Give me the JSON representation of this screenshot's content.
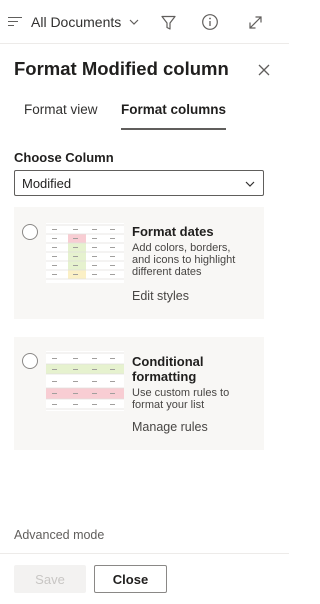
{
  "header": {
    "view_name": "All Documents",
    "icons": [
      "list-view-icon",
      "chevron-down-icon",
      "filter-icon",
      "info-icon",
      "expand-icon"
    ]
  },
  "panel": {
    "title": "Format Modified column",
    "tabs": [
      {
        "label": "Format view",
        "active": false
      },
      {
        "label": "Format columns",
        "active": true
      }
    ]
  },
  "column_picker": {
    "label": "Choose Column",
    "value": "Modified"
  },
  "options": [
    {
      "title": "Format dates",
      "description": "Add colors, borders, and icons to highlight different dates",
      "description_lines": [
        "Add colors, borders,",
        "and icons to highlight",
        "different dates"
      ],
      "action": "Edit styles"
    },
    {
      "title": "Conditional formatting",
      "title_lines": [
        "Conditional",
        "formatting"
      ],
      "description": "Use custom rules to format your list",
      "description_lines": [
        "Use custom rules to",
        "format your list"
      ],
      "action": "Manage rules"
    }
  ],
  "advanced_link": "Advanced mode",
  "footer": {
    "save_label": "Save",
    "close_label": "Close"
  },
  "colors": {
    "accent_underline": "#605e5c",
    "thumb_green": "#e6f2cf",
    "thumb_red": "#f8cdd3",
    "thumb_yellow": "#fbf0c6",
    "card_bg": "#f8f7f5"
  }
}
